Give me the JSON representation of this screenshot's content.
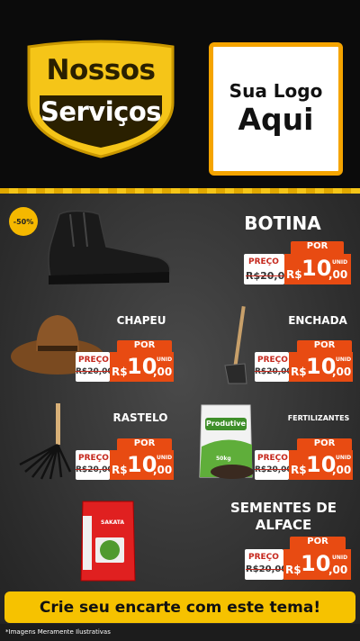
{
  "header": {
    "title_line1": "Nossos",
    "title_line2": "Serviços",
    "logo_line1": "Sua Logo",
    "logo_line2": "Aqui"
  },
  "discount_badge": "-50%",
  "products": [
    {
      "name": "BOTINA",
      "por": "POR",
      "preco": "PREÇO",
      "old": "R$20,00",
      "currency": "R$",
      "price_int": "10",
      "price_cents": ",00",
      "unit": "UNID"
    },
    {
      "name": "CHAPEU",
      "por": "POR",
      "preco": "PREÇO",
      "old": "R$20,00",
      "currency": "R$",
      "price_int": "10",
      "price_cents": ",00",
      "unit": "UNID"
    },
    {
      "name": "ENCHADA",
      "por": "POR",
      "preco": "PREÇO",
      "old": "R$20,00",
      "currency": "R$",
      "price_int": "10",
      "price_cents": ",00",
      "unit": "UNID"
    },
    {
      "name": "RASTELO",
      "por": "POR",
      "preco": "PREÇO",
      "old": "R$20,00",
      "currency": "R$",
      "price_int": "10",
      "price_cents": ",00",
      "unit": "UNID"
    },
    {
      "name": "FERTILIZANTES",
      "por": "POR",
      "preco": "PREÇO",
      "old": "R$20,00",
      "currency": "R$",
      "price_int": "10",
      "price_cents": ",00",
      "unit": "UNID"
    },
    {
      "name": "SEMENTES DE\nALFACE",
      "por": "POR",
      "preco": "PREÇO",
      "old": "R$20,00",
      "currency": "R$",
      "price_int": "10",
      "price_cents": ",00",
      "unit": "UNID"
    }
  ],
  "product_labels": {
    "fertilizer_brand": "Produtive",
    "fertilizer_weight": "50kg",
    "seed_brand": "SAKATA"
  },
  "cta": "Crie seu encarte com este tema!",
  "disclaimer": "*Imagens Meramente Ilustrativas",
  "colors": {
    "accent": "#f6c200",
    "price_orange": "#e84b12",
    "old_price_red": "#c5271c",
    "background": "#2d2d2d"
  }
}
